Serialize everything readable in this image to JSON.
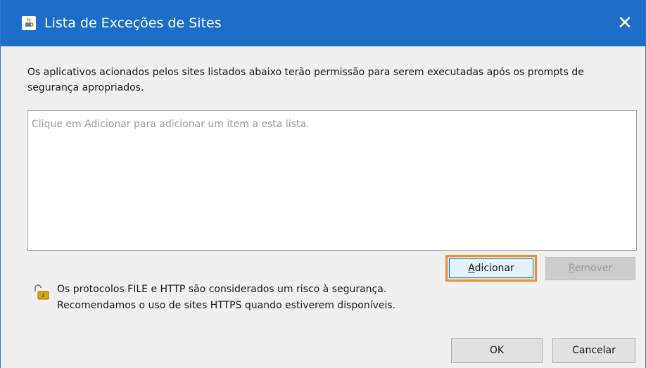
{
  "window": {
    "title": "Lista de Exceções de Sites",
    "icon": "java-icon",
    "close_glyph": "✕"
  },
  "description": "Os aplicativos acionados pelos sites listados abaixo terão permissão para serem executadas após os prompts de segurança apropriados.",
  "site_list": {
    "placeholder": "Clique em Adicionar para adicionar um item a esta lista.",
    "items": []
  },
  "buttons": {
    "add": {
      "label_mnemonic": "A",
      "label_rest": "dicionar"
    },
    "remove": {
      "label_mnemonic": "R",
      "label_rest": "emover",
      "enabled": false
    },
    "ok": "OK",
    "cancel": "Cancelar"
  },
  "security_notice": {
    "icon": "unlocked-padlock-warning-icon",
    "line1": "Os protocolos FILE e HTTP são considerados um risco à segurança.",
    "line2": "Recomendamos o uso de sites HTTPS quando estiverem disponíveis."
  },
  "colors": {
    "titlebar": "#1c6ec9",
    "highlight": "#f08b2a"
  }
}
